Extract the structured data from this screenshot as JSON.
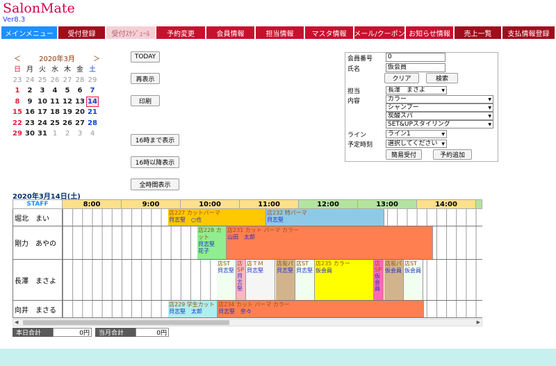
{
  "app": {
    "title": "SalonMate",
    "version": "Ver8.3"
  },
  "nav": [
    {
      "label": "メインメニュー",
      "style": "menu"
    },
    {
      "label": "受付登録",
      "style": "dark"
    },
    {
      "label": "受付ｽｹｼﾞｭｰﾙ",
      "style": "active"
    },
    {
      "label": "予約変更",
      "style": "normal"
    },
    {
      "label": "会員情報",
      "style": "normal"
    },
    {
      "label": "担当情報",
      "style": "normal"
    },
    {
      "label": "マスタ情報",
      "style": "normal"
    },
    {
      "label": "メール/クーポン",
      "style": "normal"
    },
    {
      "label": "お知らせ情報",
      "style": "normal"
    },
    {
      "label": "売上一覧",
      "style": "dark"
    },
    {
      "label": "支払情報登録",
      "style": "dark"
    }
  ],
  "calendar": {
    "prev": "＜",
    "next": "＞",
    "month_label": "2020年3月",
    "weekdays": [
      "日",
      "月",
      "火",
      "水",
      "木",
      "金",
      "土"
    ],
    "days": [
      [
        "23",
        "out"
      ],
      [
        "24",
        "out"
      ],
      [
        "25",
        "out"
      ],
      [
        "26",
        "out"
      ],
      [
        "27",
        "out"
      ],
      [
        "28",
        "out"
      ],
      [
        "29",
        "out"
      ],
      [
        "1",
        "sun"
      ],
      [
        "2",
        "wk"
      ],
      [
        "3",
        "wk"
      ],
      [
        "4",
        "wk"
      ],
      [
        "5",
        "wk"
      ],
      [
        "6",
        "wk"
      ],
      [
        "7",
        "sat"
      ],
      [
        "8",
        "sun"
      ],
      [
        "9",
        "wk"
      ],
      [
        "10",
        "wk"
      ],
      [
        "11",
        "wk"
      ],
      [
        "12",
        "wk"
      ],
      [
        "13",
        "wk"
      ],
      [
        "14",
        "today"
      ],
      [
        "15",
        "sun"
      ],
      [
        "16",
        "wk"
      ],
      [
        "17",
        "wk"
      ],
      [
        "18",
        "wk"
      ],
      [
        "19",
        "wk"
      ],
      [
        "20",
        "wk"
      ],
      [
        "21",
        "sat"
      ],
      [
        "22",
        "sun"
      ],
      [
        "23",
        "wk"
      ],
      [
        "24",
        "wk"
      ],
      [
        "25",
        "wk"
      ],
      [
        "26",
        "wk"
      ],
      [
        "27",
        "wk"
      ],
      [
        "28",
        "sat"
      ],
      [
        "29",
        "sun"
      ],
      [
        "30",
        "wk"
      ],
      [
        "31",
        "wk"
      ],
      [
        "1",
        "out"
      ],
      [
        "2",
        "out"
      ],
      [
        "3",
        "out"
      ],
      [
        "4",
        "out"
      ]
    ]
  },
  "buttons": {
    "today": "TODAY",
    "redisplay": "再表示",
    "print": "印刷",
    "until16": "16時まで表示",
    "after16": "16時以降表示",
    "all_hours": "全時間表示"
  },
  "form": {
    "member_no_label": "会員番号",
    "member_no": "0",
    "name_label": "氏名",
    "name": "仮会員",
    "clear": "クリア",
    "search": "検索",
    "staff_label": "担当",
    "staff": "長澤　まさよ",
    "content_label": "内容",
    "contents": [
      "カラー",
      "シャンプー",
      "炭酸スパ",
      "SET&UPスタイリング"
    ],
    "line_label": "ライン",
    "line": "ライン1",
    "time_label": "予定時刻",
    "time": "選択してください",
    "quick_reception": "簡易受付",
    "add_reservation": "予約追加"
  },
  "schedule": {
    "date_label": "2020年3月14日(土)",
    "staff_header": "STAFF",
    "hours": [
      "8:00",
      "9:00",
      "10:00",
      "11:00",
      "12:00",
      "13:00",
      "14:00"
    ],
    "rows": [
      {
        "staff": "堀北　まい",
        "blocks": [
          {
            "title": "店227 カットパーマ",
            "person": "貝志堅　○也",
            "color": "#ffc800"
          },
          {
            "title": "店232 特パーマ",
            "person": "貝志堅",
            "color": "#8ecae8"
          }
        ]
      },
      {
        "staff": "剛力　あやの",
        "blocks": [
          {
            "title": "店228 カット",
            "person": "貝志堅　花子",
            "color": "#90ee90"
          },
          {
            "title": "店231 カット パーマ カラー",
            "person": "山田　太郎",
            "color": "#ff7f50"
          }
        ]
      },
      {
        "staff": "長澤　まさよ",
        "blocks": [
          {
            "title": "店ST",
            "person": "貝志堅",
            "color": "#f0fff0"
          },
          {
            "title": "店SP",
            "person": "貝志堅",
            "color": "#ffb6c1"
          },
          {
            "title": "店ＴＭ",
            "person": "貝志堅",
            "color": "#f5f5f5"
          },
          {
            "title": "店炭パ",
            "person": "貝志堅",
            "color": "#d2b48c"
          },
          {
            "title": "店ST",
            "person": "貝志堅",
            "color": "#f0fff0"
          },
          {
            "title": "店235 カラー",
            "person": "仮会員",
            "color": "#ffff00"
          },
          {
            "title": "店SP",
            "person": "仮会員",
            "color": "#ff69b4"
          },
          {
            "title": "店炭パ",
            "person": "仮会員",
            "color": "#d2b48c"
          },
          {
            "title": "店ST",
            "person": "仮会員",
            "color": "#f0fff0"
          }
        ]
      },
      {
        "staff": "向井　まさる",
        "blocks": [
          {
            "title": "店229 学生カット",
            "person": "貝志堅　太郎",
            "color": "#afeeee"
          },
          {
            "title": "店234 カット パーマ カラー",
            "person": "貝志堅　奈々",
            "color": "#ff7f50"
          }
        ]
      }
    ]
  },
  "totals": {
    "today_label": "本日合計",
    "today_value": "0円",
    "month_label": "当月合計",
    "month_value": "0円"
  }
}
